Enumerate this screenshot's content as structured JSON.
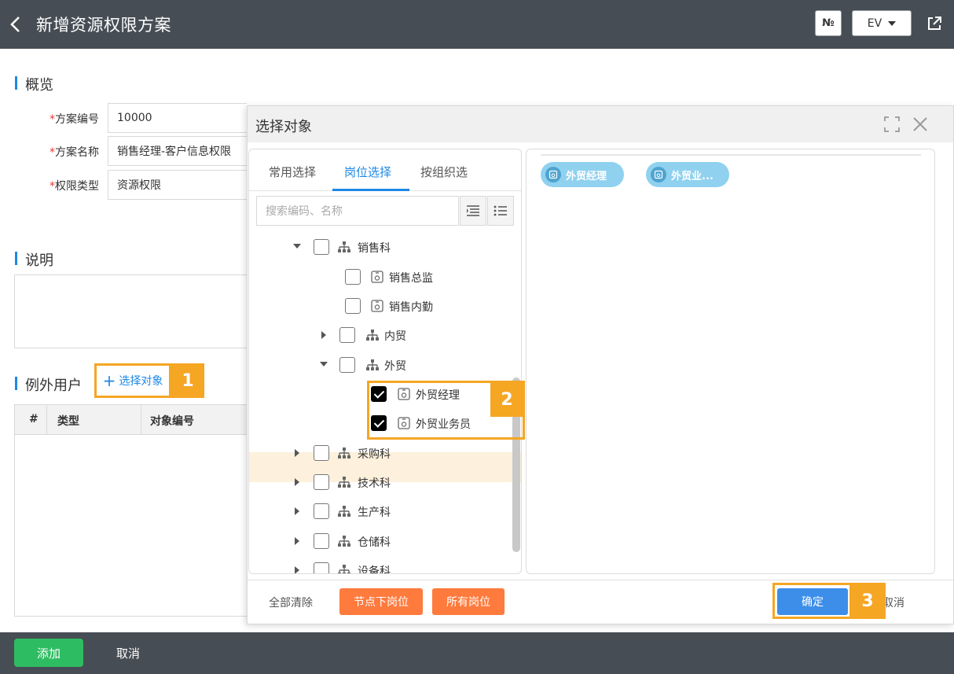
{
  "header": {
    "title": "新增资源权限方案",
    "no_button": "№",
    "ev_button": "EV"
  },
  "overview": {
    "section_title": "概览",
    "fields": [
      {
        "label": "方案编号",
        "value": "10000"
      },
      {
        "label": "方案名称",
        "value": "销售经理-客户信息权限"
      },
      {
        "label": "权限类型",
        "value": "资源权限"
      }
    ]
  },
  "description": {
    "section_title": "说明"
  },
  "exceptions": {
    "section_title": "例外用户",
    "select_link": "选择对象",
    "badge": "1",
    "columns": [
      "#",
      "类型",
      "对象编号"
    ]
  },
  "bottom": {
    "add": "添加",
    "cancel": "取消"
  },
  "dialog": {
    "title": "选择对象",
    "tabs": [
      "常用选择",
      "岗位选择",
      "按组织选"
    ],
    "active_tab": "岗位选择",
    "search_placeholder": "搜索编码、名称",
    "tree": [
      {
        "label": "销售科",
        "type": "org",
        "expand": "down",
        "checked": false
      },
      {
        "label": "销售总监",
        "type": "post",
        "expand": "none",
        "checked": false
      },
      {
        "label": "销售内勤",
        "type": "post",
        "expand": "none",
        "checked": false
      },
      {
        "label": "内贸",
        "type": "org",
        "expand": "right",
        "checked": false
      },
      {
        "label": "外贸",
        "type": "org",
        "expand": "down",
        "checked": false
      },
      {
        "label": "外贸经理",
        "type": "post",
        "expand": "none",
        "checked": true
      },
      {
        "label": "外贸业务员",
        "type": "post",
        "expand": "none",
        "checked": true
      },
      {
        "label": "采购科",
        "type": "org",
        "expand": "right",
        "checked": false
      },
      {
        "label": "技术科",
        "type": "org",
        "expand": "right",
        "checked": false
      },
      {
        "label": "生产科",
        "type": "org",
        "expand": "right",
        "checked": false
      },
      {
        "label": "仓储科",
        "type": "org",
        "expand": "right",
        "checked": false
      },
      {
        "label": "设备科",
        "type": "org",
        "expand": "right",
        "checked": false
      }
    ],
    "badge2": "2",
    "selected_tags": [
      "外贸经理",
      "外贸业..."
    ],
    "footer": {
      "clear_all": "全部清除",
      "node_posts": "节点下岗位",
      "all_posts": "所有岗位",
      "confirm": "确定",
      "badge3": "3",
      "cancel": "取消"
    }
  },
  "colors": {
    "accent": "#1e88e5",
    "orange": "#ff7a3d",
    "highlight": "#f5a623",
    "green": "#2ebc62",
    "header": "#474d54"
  }
}
